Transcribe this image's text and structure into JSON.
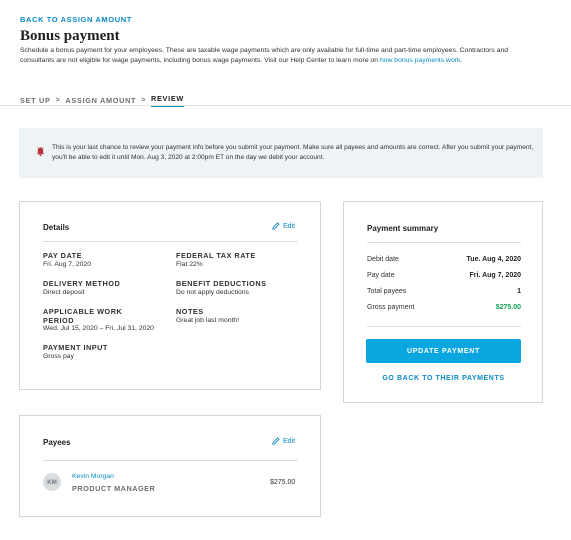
{
  "header": {
    "back_link": "BACK TO ASSIGN AMOUNT",
    "title": "Bonus payment",
    "description": "Schedule a bonus payment for your employees. These are taxable wage payments which are only available for full-time and part-time employees. Contractors and consultants are not eligible for wage payments, including bonus wage payments. Visit our Help Center to learn more on ",
    "description_link": "how bonus payments work",
    "description_end": "."
  },
  "steps": {
    "setup": "SET UP",
    "assign": "ASSIGN AMOUNT",
    "review": "REVIEW",
    "separator": ">"
  },
  "notice": {
    "icon": "bell-icon",
    "text": "This is your last chance to review your payment info before you submit your payment. Make sure all payees and amounts are correct. After you submit your payment, you'll be able to edit it until Mon. Aug 3, 2020 at 2:00pm ET on the day we debit your account."
  },
  "details": {
    "title": "Details",
    "edit": "Edit",
    "pay_date_label": "PAY DATE",
    "pay_date": "Fri. Aug 7, 2020",
    "federal_tax_label": "FEDERAL TAX RATE",
    "federal_tax": "Flat 22%",
    "delivery_label": "DELIVERY METHOD",
    "delivery": "Direct deposit",
    "benefit_label": "BENEFIT DEDUCTIONS",
    "benefit": "Do not apply deductions",
    "work_period_label_1": "APPLICABLE WORK",
    "work_period_label_2": "PERIOD",
    "work_period": "Wed. Jul 15, 2020 – Fri. Jul 31, 2020",
    "notes_label": "NOTES",
    "notes": "Great job last month!",
    "payment_input_label": "PAYMENT INPUT",
    "payment_input": "Gross pay"
  },
  "summary": {
    "title": "Payment summary",
    "rows": [
      {
        "label": "Debit date",
        "value": "Tue. Aug 4, 2020"
      },
      {
        "label": "Pay date",
        "value": "Fri. Aug 7, 2020"
      },
      {
        "label": "Total payees",
        "value": "1"
      },
      {
        "label": "Gross payment",
        "value": "$275.00"
      }
    ],
    "update_button": "UPDATE PAYMENT",
    "back_button": "GO BACK TO THEIR PAYMENTS",
    "accent_green": "#12a150"
  },
  "payees": {
    "title": "Payees",
    "edit": "Edit",
    "items": [
      {
        "initials": "KM",
        "name": "Kevin Morgan",
        "role": "PRODUCT MANAGER",
        "amount": "$275.00"
      }
    ]
  },
  "colors": {
    "link": "#0a8ac4",
    "button": "#0aa6df"
  }
}
